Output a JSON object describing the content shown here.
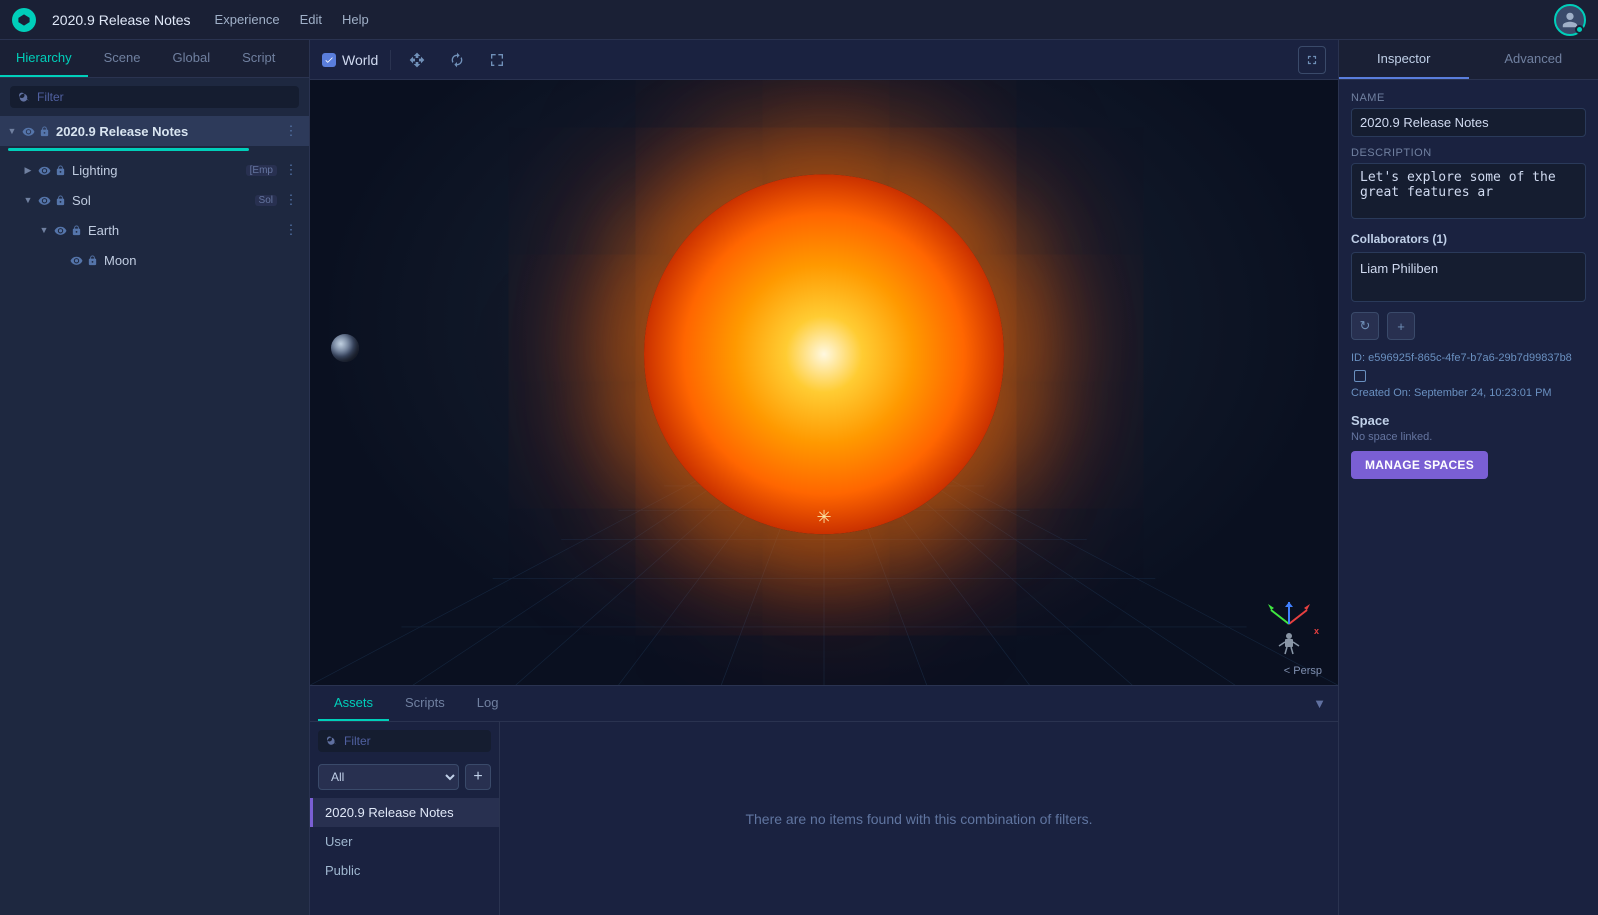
{
  "app": {
    "logo": "E",
    "title": "2020.9 Release Notes"
  },
  "header": {
    "nav": [
      "Experience",
      "Edit",
      "Help"
    ]
  },
  "left_panel": {
    "tabs": [
      "Hierarchy",
      "Scene",
      "Global",
      "Script"
    ],
    "active_tab": "Hierarchy",
    "filter_placeholder": "Filter",
    "tree": [
      {
        "id": "root",
        "label": "2020.9 Release Notes",
        "indent": 0,
        "expanded": true,
        "has_arrow": true,
        "visible": true,
        "locked": true,
        "is_root": true
      },
      {
        "id": "lighting",
        "label": "Lighting",
        "indent": 1,
        "expanded": false,
        "has_arrow": true,
        "visible": true,
        "locked": true,
        "tag": "[Emp"
      },
      {
        "id": "sol",
        "label": "Sol",
        "indent": 1,
        "expanded": true,
        "has_arrow": true,
        "visible": true,
        "locked": true,
        "tag": "Sol"
      },
      {
        "id": "earth",
        "label": "Earth",
        "indent": 2,
        "expanded": true,
        "has_arrow": true,
        "visible": true,
        "locked": true
      },
      {
        "id": "moon",
        "label": "Moon",
        "indent": 3,
        "expanded": false,
        "has_arrow": false,
        "visible": true,
        "locked": true
      }
    ]
  },
  "toolbar": {
    "world_label": "World",
    "world_checked": true
  },
  "viewport": {
    "label": "< Persp"
  },
  "bottom_panel": {
    "tabs": [
      "Assets",
      "Scripts",
      "Log"
    ],
    "active_tab": "Assets",
    "filter_placeholder": "Filter",
    "type_options": [
      "All"
    ],
    "selected_type": "All",
    "add_label": "+",
    "list_items": [
      {
        "label": "2020.9 Release Notes",
        "active": true
      },
      {
        "label": "User",
        "active": false
      },
      {
        "label": "Public",
        "active": false
      }
    ],
    "empty_message": "There are no items found with this combination of filters."
  },
  "inspector": {
    "tabs": [
      "Inspector",
      "Advanced"
    ],
    "active_tab": "Inspector",
    "name_label": "Name",
    "name_value": "2020.9 Release Notes",
    "description_label": "Description",
    "description_value": "Let's explore some of the great features ar",
    "collaborators_label": "Collaborators (1)",
    "collaborator_name": "Liam Philiben",
    "id_label": "ID:",
    "id_value": "e596925f-865c-4fe7-b7a6-29b7d99837b8",
    "created_label": "Created On:",
    "created_value": "September 24, 10:23:01 PM",
    "space_label": "Space",
    "space_no_link": "No space linked.",
    "manage_spaces_label": "MANAGE SPACES",
    "refresh_icon": "↻",
    "add_icon": "+"
  }
}
